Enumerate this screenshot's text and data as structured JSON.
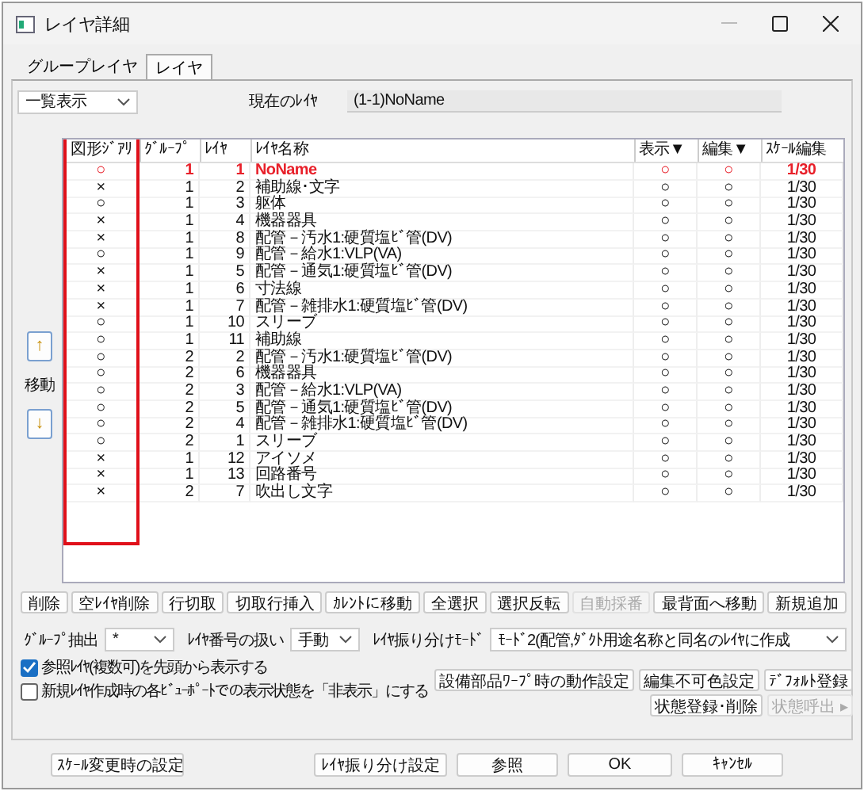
{
  "window": {
    "title": "レイヤ詳細"
  },
  "tabs": [
    {
      "label": "グループレイヤ",
      "selected": false
    },
    {
      "label": "レイヤ",
      "selected": true
    }
  ],
  "view_select": {
    "value": "一覧表示"
  },
  "current_layer": {
    "label": "現在のﾚｲﾔ",
    "value": "(1-1)NoName"
  },
  "move": {
    "up": "↑",
    "label": "移動",
    "down": "↓"
  },
  "table": {
    "columns": [
      "図形ｼﾞｱﾘ",
      "ｸﾞﾙｰﾌﾟ",
      "ﾚｲﾔ",
      "ﾚｲﾔ名称",
      "表示▼",
      "編集▼",
      "ｽｹｰﾙ編集"
    ],
    "rows": [
      {
        "current": true,
        "cells": [
          "○",
          "1",
          "1",
          "NoName",
          "○",
          "○",
          "1/30"
        ]
      },
      {
        "current": false,
        "cells": [
          "×",
          "1",
          "2",
          "補助線･文字",
          "○",
          "○",
          "1/30"
        ]
      },
      {
        "current": false,
        "cells": [
          "○",
          "1",
          "3",
          "躯体",
          "○",
          "○",
          "1/30"
        ]
      },
      {
        "current": false,
        "cells": [
          "×",
          "1",
          "4",
          "機器器具",
          "○",
          "○",
          "1/30"
        ]
      },
      {
        "current": false,
        "cells": [
          "×",
          "1",
          "8",
          "配管－汚水1:硬質塩ﾋﾞ管(DV)",
          "○",
          "○",
          "1/30"
        ]
      },
      {
        "current": false,
        "cells": [
          "○",
          "1",
          "9",
          "配管－給水1:VLP(VA)",
          "○",
          "○",
          "1/30"
        ]
      },
      {
        "current": false,
        "cells": [
          "×",
          "1",
          "5",
          "配管－通気1:硬質塩ﾋﾞ管(DV)",
          "○",
          "○",
          "1/30"
        ]
      },
      {
        "current": false,
        "cells": [
          "×",
          "1",
          "6",
          "寸法線",
          "○",
          "○",
          "1/30"
        ]
      },
      {
        "current": false,
        "cells": [
          "×",
          "1",
          "7",
          "配管－雑排水1:硬質塩ﾋﾞ管(DV)",
          "○",
          "○",
          "1/30"
        ]
      },
      {
        "current": false,
        "cells": [
          "○",
          "1",
          "10",
          "スリーブ",
          "○",
          "○",
          "1/30"
        ]
      },
      {
        "current": false,
        "cells": [
          "○",
          "1",
          "11",
          "補助線",
          "○",
          "○",
          "1/30"
        ]
      },
      {
        "current": false,
        "cells": [
          "○",
          "2",
          "2",
          "配管－汚水1:硬質塩ﾋﾞ管(DV)",
          "○",
          "○",
          "1/30"
        ]
      },
      {
        "current": false,
        "cells": [
          "○",
          "2",
          "6",
          "機器器具",
          "○",
          "○",
          "1/30"
        ]
      },
      {
        "current": false,
        "cells": [
          "○",
          "2",
          "3",
          "配管－給水1:VLP(VA)",
          "○",
          "○",
          "1/30"
        ]
      },
      {
        "current": false,
        "cells": [
          "○",
          "2",
          "5",
          "配管－通気1:硬質塩ﾋﾞ管(DV)",
          "○",
          "○",
          "1/30"
        ]
      },
      {
        "current": false,
        "cells": [
          "○",
          "2",
          "4",
          "配管－雑排水1:硬質塩ﾋﾞ管(DV)",
          "○",
          "○",
          "1/30"
        ]
      },
      {
        "current": false,
        "cells": [
          "○",
          "2",
          "1",
          "スリーブ",
          "○",
          "○",
          "1/30"
        ]
      },
      {
        "current": false,
        "cells": [
          "×",
          "1",
          "12",
          "アイソメ",
          "○",
          "○",
          "1/30"
        ]
      },
      {
        "current": false,
        "cells": [
          "×",
          "1",
          "13",
          "回路番号",
          "○",
          "○",
          "1/30"
        ]
      },
      {
        "current": false,
        "cells": [
          "×",
          "2",
          "7",
          "吹出し文字",
          "○",
          "○",
          "1/30"
        ]
      }
    ]
  },
  "action_buttons": [
    {
      "label": "削除",
      "disabled": false
    },
    {
      "label": "空ﾚｲﾔ削除",
      "disabled": false
    },
    {
      "label": "行切取",
      "disabled": false
    },
    {
      "label": "切取行挿入",
      "disabled": false
    },
    {
      "label": "ｶﾚﾝﾄに移動",
      "disabled": false
    },
    {
      "label": "全選択",
      "disabled": false
    },
    {
      "label": "選択反転",
      "disabled": false
    },
    {
      "label": "自動採番",
      "disabled": true
    },
    {
      "label": "最背面へ移動",
      "disabled": false
    },
    {
      "label": "新規追加",
      "disabled": false
    }
  ],
  "filters": [
    {
      "label": "ｸﾞﾙｰﾌﾟ抽出",
      "value": "*"
    },
    {
      "label": "ﾚｲﾔ番号の扱い",
      "value": "手動"
    },
    {
      "label": "ﾚｲﾔ振り分けﾓｰﾄﾞ",
      "value": "ﾓｰﾄﾞ2(配管,ﾀﾞｸﾄ用途名称と同名のﾚｲﾔに作成"
    }
  ],
  "options": [
    {
      "label": "参照ﾚｲﾔ(複数可)を先頭から表示する",
      "checked": true
    },
    {
      "label": "新規ﾚｲﾔ作成時の各ﾋﾞｭｰﾎﾟｰﾄでの表示状態を「非表示」にする",
      "checked": false
    }
  ],
  "side_buttons": [
    {
      "label": "設備部品ﾜｰﾌﾟ時の動作設定",
      "disabled": false
    },
    {
      "label": "編集不可色設定",
      "disabled": false
    },
    {
      "label": "ﾃﾞﾌｫﾙﾄ登録",
      "disabled": false
    },
    {
      "label": "状態登録･削除",
      "disabled": false
    },
    {
      "label": "状態呼出 ▸",
      "disabled": true
    }
  ],
  "footer_buttons": [
    "ｽｹｰﾙ変更時の設定",
    "ﾚｲﾔ振り分け設定",
    "参照",
    "OK",
    "ｷｬﾝｾﾙ"
  ]
}
